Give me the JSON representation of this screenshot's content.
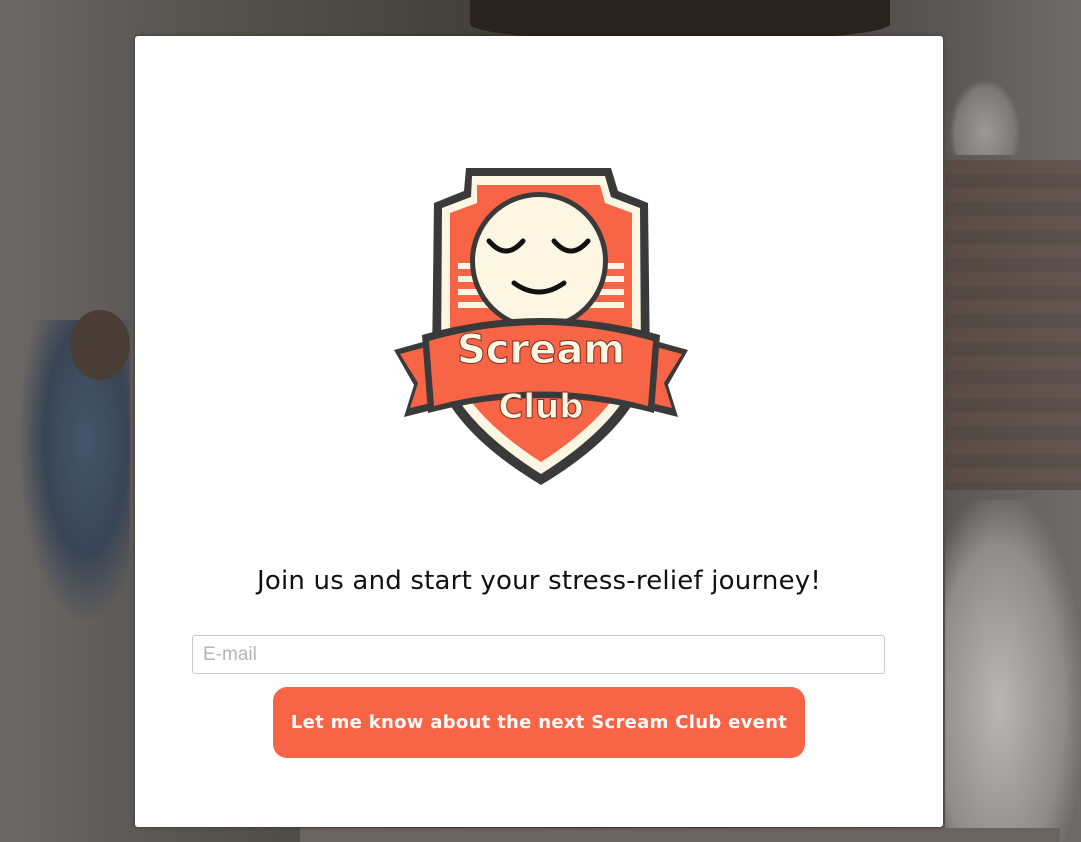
{
  "modal": {
    "logo": {
      "icon": "scream-club-shield-logo",
      "line1": "Scream",
      "line2": "Club"
    },
    "headline": "Join us and start your stress-relief journey!",
    "email": {
      "placeholder": "E-mail",
      "value": ""
    },
    "cta_label": "Let me know about the next Scream Club event"
  },
  "colors": {
    "accent": "#f76446",
    "logo_cream": "#fdf6e3",
    "logo_outline": "#3a3a3a"
  }
}
